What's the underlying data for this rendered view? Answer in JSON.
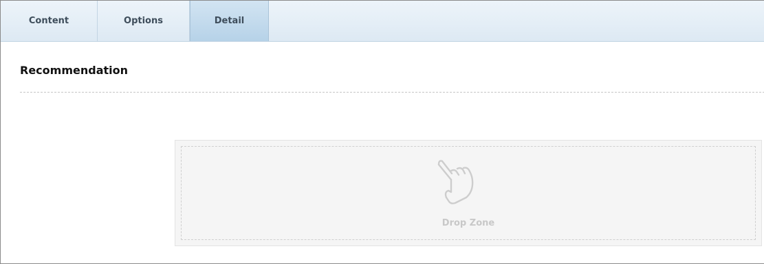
{
  "tabs": {
    "content": "Content",
    "options": "Options",
    "detail": "Detail",
    "active": "Detail"
  },
  "section": {
    "title": "Recommendation"
  },
  "dropzone": {
    "label": "Drop Zone",
    "icon": "hand-pointer-icon"
  },
  "colors": {
    "tab_bar": "#dde9f3",
    "active_tab": "#b6d2e8",
    "dropzone_bg": "#f5f5f5",
    "muted_text": "#c8c8c8"
  }
}
